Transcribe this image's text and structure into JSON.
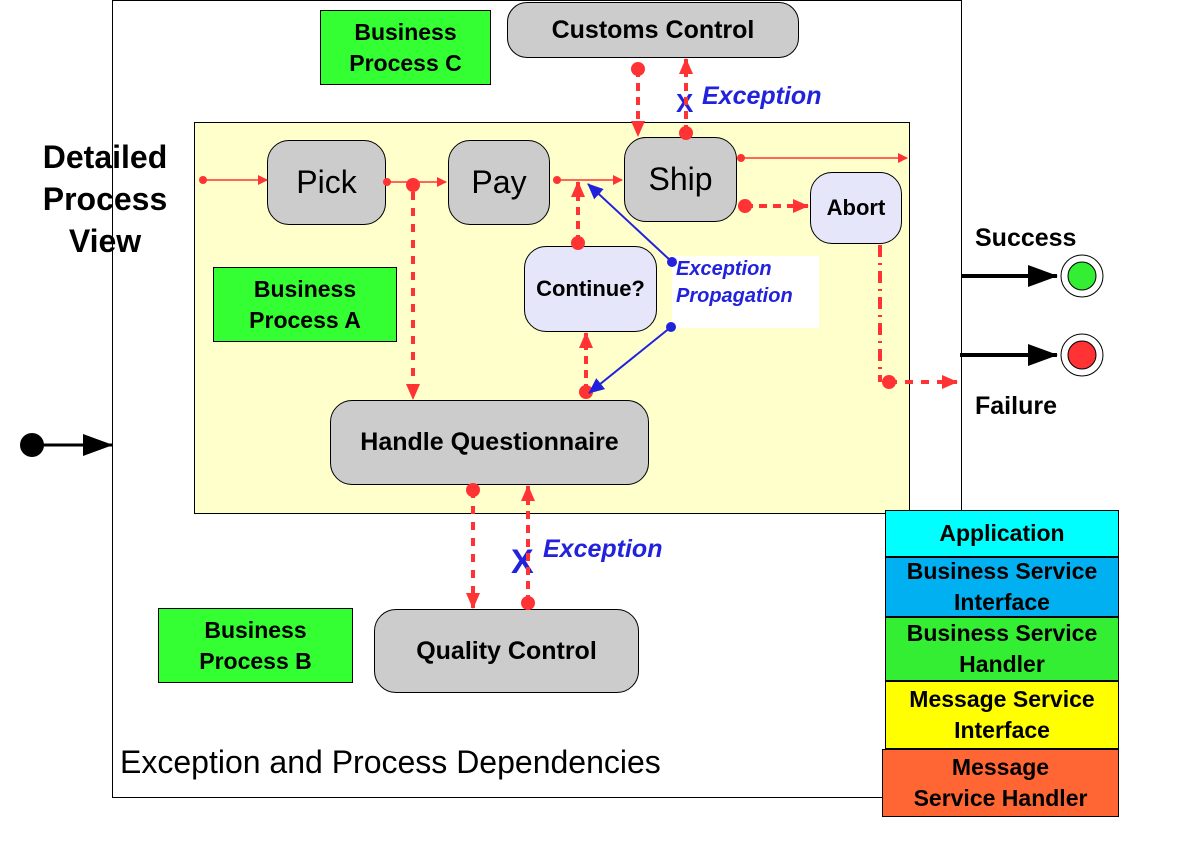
{
  "diagram": {
    "side_title": "Detailed\nProcess\nView",
    "footer_title": "Exception and Process Dependencies",
    "business_processes": [
      {
        "id": "c",
        "label": "Business\nProcess C"
      },
      {
        "id": "a",
        "label": "Business\nProcess A"
      },
      {
        "id": "b",
        "label": "Business\nProcess B"
      }
    ],
    "tasks": {
      "customs_control": "Customs Control",
      "pick": "Pick",
      "pay": "Pay",
      "ship": "Ship",
      "abort": "Abort",
      "continue": "Continue?",
      "handle_questionnaire": "Handle Questionnaire",
      "quality_control": "Quality Control"
    },
    "exception_labels": {
      "top": "Exception",
      "bottom": "Exception",
      "propagation": "Exception\nPropagation",
      "blocked_marker": "X"
    },
    "end_states": {
      "success": {
        "label": "Success",
        "color": "#33ee33"
      },
      "failure": {
        "label": "Failure",
        "color": "#ff3333"
      }
    },
    "legend_stack": [
      {
        "label": "Application",
        "color": "#00ffff"
      },
      {
        "label": "Business Service\nInterface",
        "color": "#00b0f0"
      },
      {
        "label": "Business Service\nHandler",
        "color": "#33ee33"
      },
      {
        "label": "Message Service\nInterface",
        "color": "#ffff00"
      },
      {
        "label": "Message\nService Handler",
        "color": "#ff6633"
      }
    ],
    "colors": {
      "flow": "#ff3333",
      "exception": "#2222dd",
      "inner_background": "#ffffcc",
      "task_fill": "#cccccc",
      "decision_fill": "#e6e6fa"
    }
  }
}
